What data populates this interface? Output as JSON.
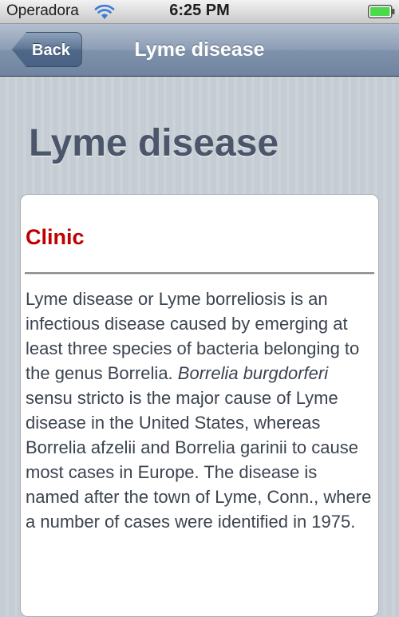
{
  "status_bar": {
    "carrier": "Operadora",
    "time": "6:25 PM"
  },
  "nav_bar": {
    "back_label": "Back",
    "title": "Lyme disease"
  },
  "page": {
    "heading": "Lyme disease"
  },
  "section": {
    "title": "Clinic",
    "text_part1": "Lyme disease or Lyme borreliosis is an infectious disease caused by emerging at least three species of bacteria belonging to the genus Borrelia. ",
    "text_italic": "Borrelia burgdorferi",
    "text_part2": " sensu stricto is the major cause of Lyme disease in the United States, whereas Borrelia afzelii and Borrelia garinii to cause most cases in Europe. The disease is named after the town of Lyme, Conn., where a number of cases were identified in 1975."
  }
}
